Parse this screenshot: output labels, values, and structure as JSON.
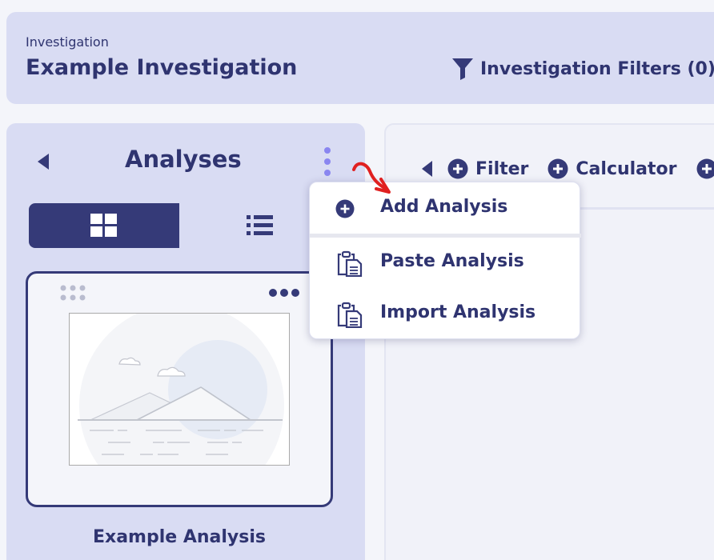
{
  "header": {
    "small_label": "Investigation",
    "title": "Example Investigation",
    "filters_label": "Investigation Filters (0)"
  },
  "analyses_panel": {
    "title": "Analyses",
    "view_toggle": {
      "selected": "grid"
    },
    "cards": [
      {
        "label": "Example Analysis"
      }
    ]
  },
  "toolbar": {
    "items": [
      {
        "label": "Filter"
      },
      {
        "label": "Calculator"
      }
    ]
  },
  "dropdown_menu": {
    "items": [
      {
        "label": "Add Analysis",
        "icon": "plus-circle-icon"
      },
      {
        "label": "Paste Analysis",
        "icon": "clipboard-icon"
      },
      {
        "label": "Import Analysis",
        "icon": "clipboard-icon"
      }
    ]
  },
  "colors": {
    "primary": "#353a78",
    "text": "#2f3470",
    "panel_bg": "#d9dcf3",
    "accent_dots": "#8a86f0",
    "annotation_arrow": "#e02020"
  }
}
